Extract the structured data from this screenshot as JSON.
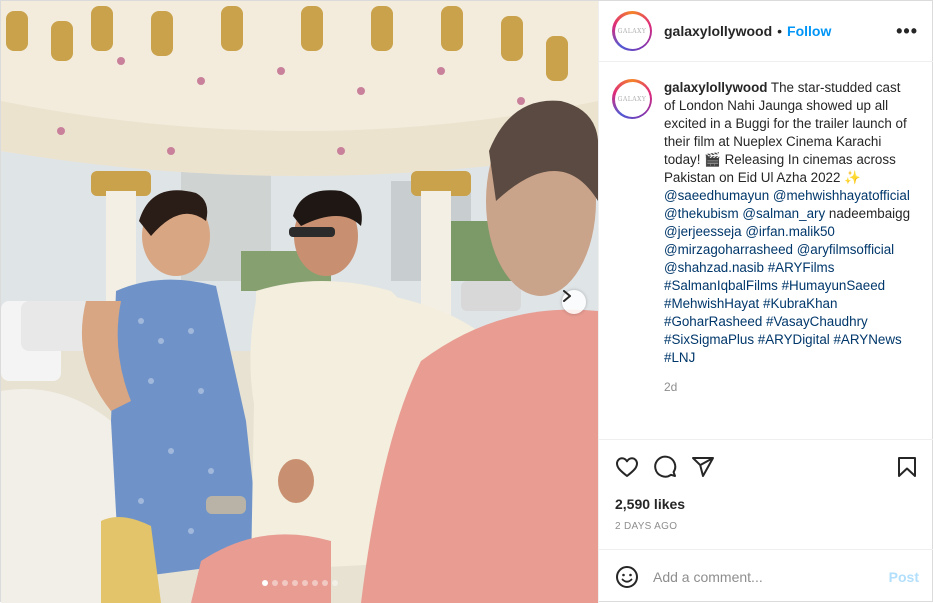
{
  "header": {
    "username": "galaxylollywood",
    "separator": "•",
    "follow_label": "Follow",
    "more_label": "•••",
    "avatar_text": "GALAXY"
  },
  "caption": {
    "username": "galaxylollywood",
    "text_part1": " The star-studded cast of London Nahi Jaunga showed up all excited in a Buggi for the trailer launch of their film at Nueplex Cinema Karachi today! 🎬 Releasing In cinemas across Pakistan on Eid Ul Azha 2022 ✨ ",
    "mentions": [
      "@saeedhumayun",
      "@mehwishhayatofficial",
      "@thekubism",
      "@salman_ary"
    ],
    "plain_name": " nadeembaigg ",
    "mentions2": [
      "@jerjeesseja",
      "@irfan.malik50",
      "@mirzagoharrasheed",
      "@aryfilmsofficial",
      "@shahzad.nasib"
    ],
    "hashtags": [
      "#ARYFilms",
      "#SalmanIqbalFilms",
      "#HumayunSaeed",
      "#MehwishHayat",
      "#KubraKhan",
      "#GoharRasheed",
      "#VasayChaudhry",
      "#SixSigmaPlus",
      "#ARYDigital",
      "#ARYNews",
      "#LNJ"
    ],
    "time_ago": "2d"
  },
  "actions": {
    "icons": [
      "heart-icon",
      "comment-icon",
      "share-icon",
      "bookmark-icon"
    ]
  },
  "likes_text": "2,590 likes",
  "date_text": "2 DAYS AGO",
  "comment": {
    "placeholder": "Add a comment...",
    "post_label": "Post"
  },
  "carousel": {
    "total_slides": 8,
    "current_slide": 1
  },
  "colors": {
    "link": "#0095f6",
    "tag": "#00376b",
    "muted": "#8e8e8e",
    "post_disabled": "#b2dffc"
  }
}
